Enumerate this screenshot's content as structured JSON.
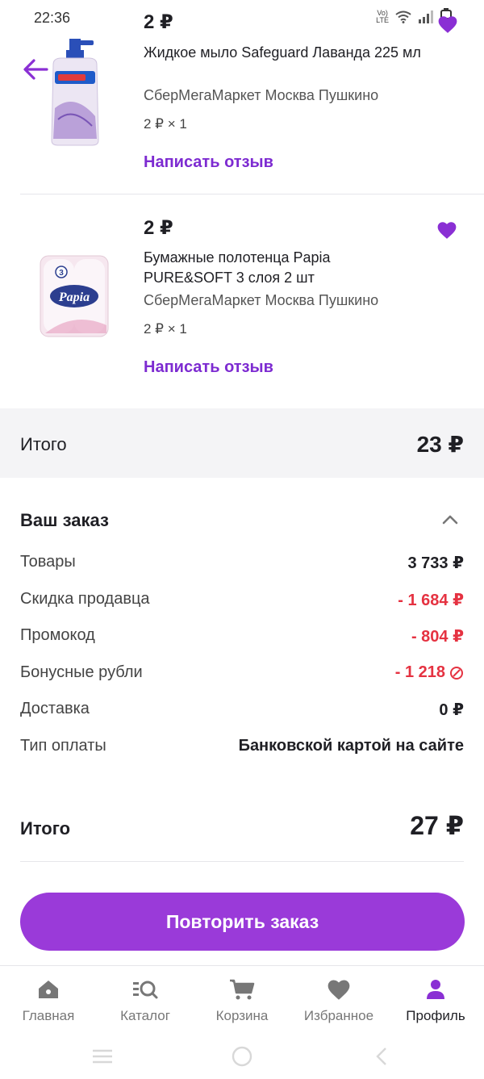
{
  "status_bar": {
    "time": "22:36",
    "network_label_top": "Vo)",
    "network_label_bottom": "LTE"
  },
  "products": [
    {
      "price": "2 ₽",
      "name": "Жидкое мыло Safeguard Лаванда 225 мл",
      "store": "СберМегаМаркет Москва Пушкино",
      "quantity": "2 ₽ × 1",
      "review_label": "Написать отзыв",
      "image_icon": "soap-bottle"
    },
    {
      "price": "2 ₽",
      "name": "Бумажные полотенца Papia PURE&SOFT 3 слоя 2 шт",
      "store": "СберМегаМаркет Москва Пушкино",
      "quantity": "2 ₽ × 1",
      "review_label": "Написать отзыв",
      "image_icon": "paper-towels",
      "image_brand": "Papia",
      "image_badge": "3"
    }
  ],
  "subtotal": {
    "label": "Итого",
    "value": "23 ₽"
  },
  "order": {
    "title": "Ваш заказ",
    "rows": [
      {
        "label": "Товары",
        "value": "3 733 ₽",
        "negative": false
      },
      {
        "label": "Скидка продавца",
        "value": "- 1 684 ₽",
        "negative": true
      },
      {
        "label": "Промокод",
        "value": "- 804 ₽",
        "negative": true
      },
      {
        "label": "Бонусные рубли",
        "value": "- 1 218",
        "negative": true,
        "icon": "bonus-icon"
      },
      {
        "label": "Доставка",
        "value": "0 ₽",
        "negative": false
      },
      {
        "label": "Тип оплаты",
        "value": "Банковской картой на сайте",
        "negative": false
      }
    ]
  },
  "grand_total": {
    "label": "Итого",
    "value": "27 ₽"
  },
  "repeat_order_label": "Повторить заказ",
  "tabbar": {
    "tabs": [
      {
        "label": "Главная",
        "icon": "home-icon",
        "active": false
      },
      {
        "label": "Каталог",
        "icon": "catalog-search-icon",
        "active": false
      },
      {
        "label": "Корзина",
        "icon": "cart-icon",
        "active": false
      },
      {
        "label": "Избранное",
        "icon": "heart-icon",
        "active": false
      },
      {
        "label": "Профиль",
        "icon": "profile-icon",
        "active": true
      }
    ]
  },
  "colors": {
    "accent": "#7d2bd1",
    "button": "#9a3ad9",
    "negative": "#e53241",
    "band": "#f4f4f6"
  }
}
